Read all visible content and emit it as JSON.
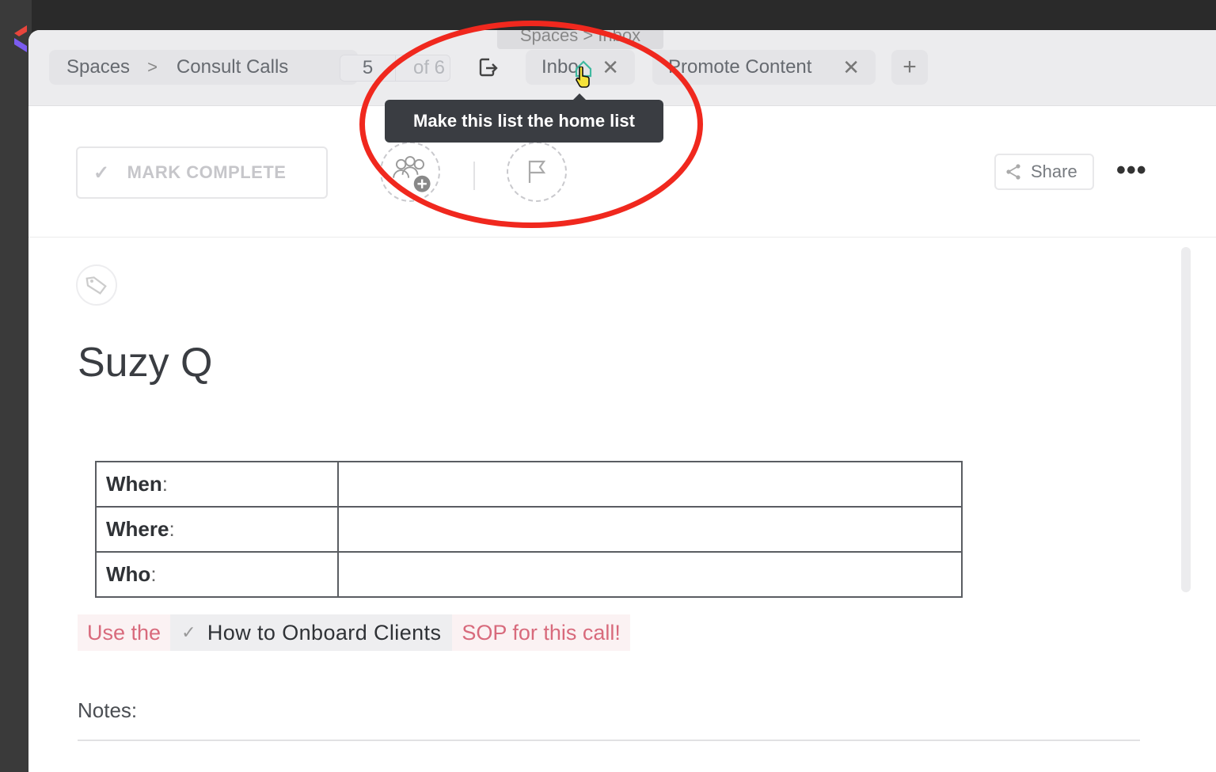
{
  "breadcrumb": {
    "root": "Spaces",
    "separator": ">",
    "current": "Consult Calls"
  },
  "pager": {
    "current": "5",
    "of_text": "of 6"
  },
  "tabs": [
    {
      "label": "Inbo",
      "close": "✕"
    },
    {
      "label": "Promote Content",
      "close": "✕"
    }
  ],
  "tab_add": "+",
  "hover_path": "Spaces > Inbox",
  "tooltip": "Make this list the home list",
  "toolbar": {
    "mark_complete": "MARK COMPLETE",
    "share": "Share",
    "more": "•••"
  },
  "task": {
    "title": "Suzy Q"
  },
  "info_table": [
    {
      "key": "When",
      "colon": ":",
      "value": ""
    },
    {
      "key": "Where",
      "colon": ":",
      "value": ""
    },
    {
      "key": "Who",
      "colon": ":",
      "value": ""
    }
  ],
  "sop": {
    "prefix": "Use the",
    "mention": "How to Onboard Clients",
    "suffix": "SOP for this call!"
  },
  "notes_label": "Notes:",
  "colors": {
    "annotation": "#f0281e",
    "tooltip_bg": "#3a3d42",
    "sop_text": "#d86a7c"
  },
  "icons": [
    "export-icon",
    "home-icon",
    "cursor-icon",
    "assignee-add-icon",
    "flag-icon",
    "share-icon",
    "tag-icon"
  ]
}
